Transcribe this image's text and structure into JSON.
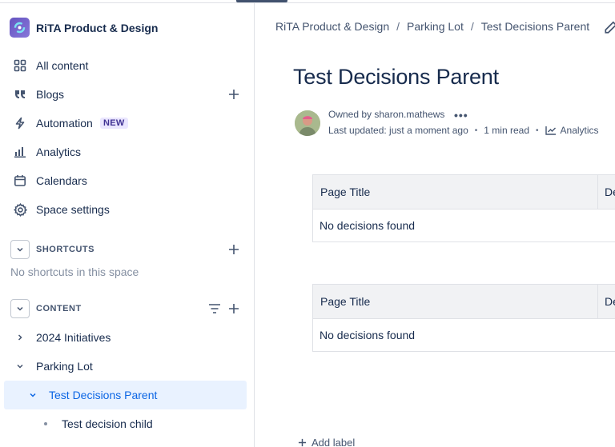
{
  "space": {
    "name": "RiTA Product & Design"
  },
  "sidebar": {
    "nav": [
      {
        "label": "All content",
        "icon": "grid-icon"
      },
      {
        "label": "Blogs",
        "icon": "quote-icon"
      },
      {
        "label": "Automation",
        "icon": "lightning-icon",
        "badge": "NEW"
      },
      {
        "label": "Analytics",
        "icon": "bar-chart-icon"
      },
      {
        "label": "Calendars",
        "icon": "calendar-icon"
      },
      {
        "label": "Space settings",
        "icon": "gear-icon"
      }
    ],
    "shortcuts": {
      "title": "SHORTCUTS",
      "empty": "No shortcuts in this space"
    },
    "content": {
      "title": "CONTENT",
      "tree": [
        {
          "label": "2024 Initiatives",
          "state": "collapsed"
        },
        {
          "label": "Parking Lot",
          "state": "expanded"
        },
        {
          "label": "Test Decisions Parent",
          "state": "expanded",
          "selected": true
        },
        {
          "label": "Test decision child",
          "state": "leaf"
        }
      ]
    }
  },
  "breadcrumb": [
    "RiTA Product & Design",
    "Parking Lot",
    "Test Decisions Parent"
  ],
  "page": {
    "title": "Test Decisions Parent",
    "owned_by": "Owned by sharon.mathews",
    "last_updated": "Last updated: just a moment ago",
    "read_time": "1 min read",
    "analytics": "Analytics"
  },
  "tables": [
    {
      "col1": "Page Title",
      "col2": "De",
      "empty": "No decisions found"
    },
    {
      "col1": "Page Title",
      "col2": "De",
      "empty": "No decisions found"
    }
  ],
  "add_label": "Add label",
  "colors": {
    "accent": "#0c66e4",
    "selected_bg": "#e9f2ff",
    "text": "#172b4d",
    "muted": "#44546f"
  }
}
